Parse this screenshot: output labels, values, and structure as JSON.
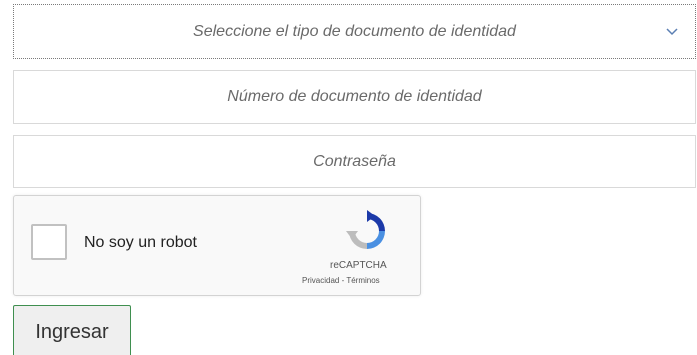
{
  "form": {
    "doc_type_select": {
      "placeholder": "Seleccione el tipo de documento de identidad",
      "icon": "chevron-down-icon"
    },
    "doc_number": {
      "placeholder": "Número de documento de identidad",
      "value": ""
    },
    "password": {
      "placeholder": "Contraseña",
      "value": ""
    },
    "recaptcha": {
      "checkbox_label": "No soy un robot",
      "brand": "reCAPTCHA",
      "privacy_link": "Privacidad",
      "separator": " - ",
      "terms_link": "Términos",
      "logo_icon": "recaptcha-logo-icon"
    },
    "submit_label": "Ingresar"
  },
  "colors": {
    "field_border": "#d9d9d9",
    "placeholder_text": "#6a6a6a",
    "button_border": "#3f8f4f",
    "button_bg": "#efefef",
    "recaptcha_bg": "#f9f9f9",
    "recaptcha_blue": "#4a90e2",
    "recaptcha_grey": "#bdbdbd"
  }
}
